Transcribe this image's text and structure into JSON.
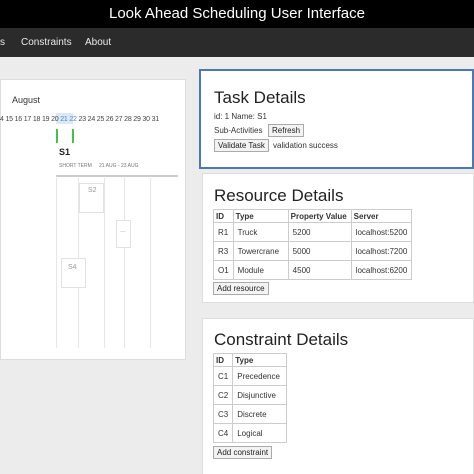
{
  "window": {
    "title": "Look Ahead Scheduling User Interface"
  },
  "nav": {
    "items": [
      "s",
      "Constraints",
      "About"
    ]
  },
  "gantt": {
    "month": "August",
    "days_before": "4 15 16 17 18 19 20",
    "days_highlight": "21 22",
    "days_after": "23 24 25 26 27 28 29 30 31",
    "selected_task": {
      "name": "S1",
      "term": "SHORT TERM",
      "range": "21 AUG - 23 AUG"
    },
    "other_tasks": [
      "S2",
      "S4"
    ],
    "ellipsis": "..."
  },
  "task_details": {
    "title": "Task Details",
    "id_line": "id: 1 Name: S1",
    "subactivities_label": "Sub-Activities",
    "refresh_button": "Refresh",
    "validate_button": "Validate Task",
    "validation_status": "validation success"
  },
  "resource_details": {
    "title": "Resource Details",
    "headers": [
      "ID",
      "Type",
      "Property Value",
      "Server"
    ],
    "rows": [
      [
        "R1",
        "Truck",
        "5200",
        "localhost:5200"
      ],
      [
        "R3",
        "Towercrane",
        "5000",
        "localhost:7200"
      ],
      [
        "O1",
        "Module",
        "4500",
        "localhost:6200"
      ]
    ],
    "add_button": "Add resource"
  },
  "constraint_details": {
    "title": "Constraint Details",
    "headers": [
      "ID",
      "Type"
    ],
    "rows": [
      [
        "C1",
        "Precedence"
      ],
      [
        "C2",
        "Disjunctive"
      ],
      [
        "C3",
        "Discrete"
      ],
      [
        "C4",
        "Logical"
      ]
    ],
    "add_button": "Add constraint"
  },
  "colors": {
    "accent": "#4a7ab5",
    "bar": "#3ec63e",
    "navbar": "#2b2b2b",
    "titlebar": "#000000"
  }
}
